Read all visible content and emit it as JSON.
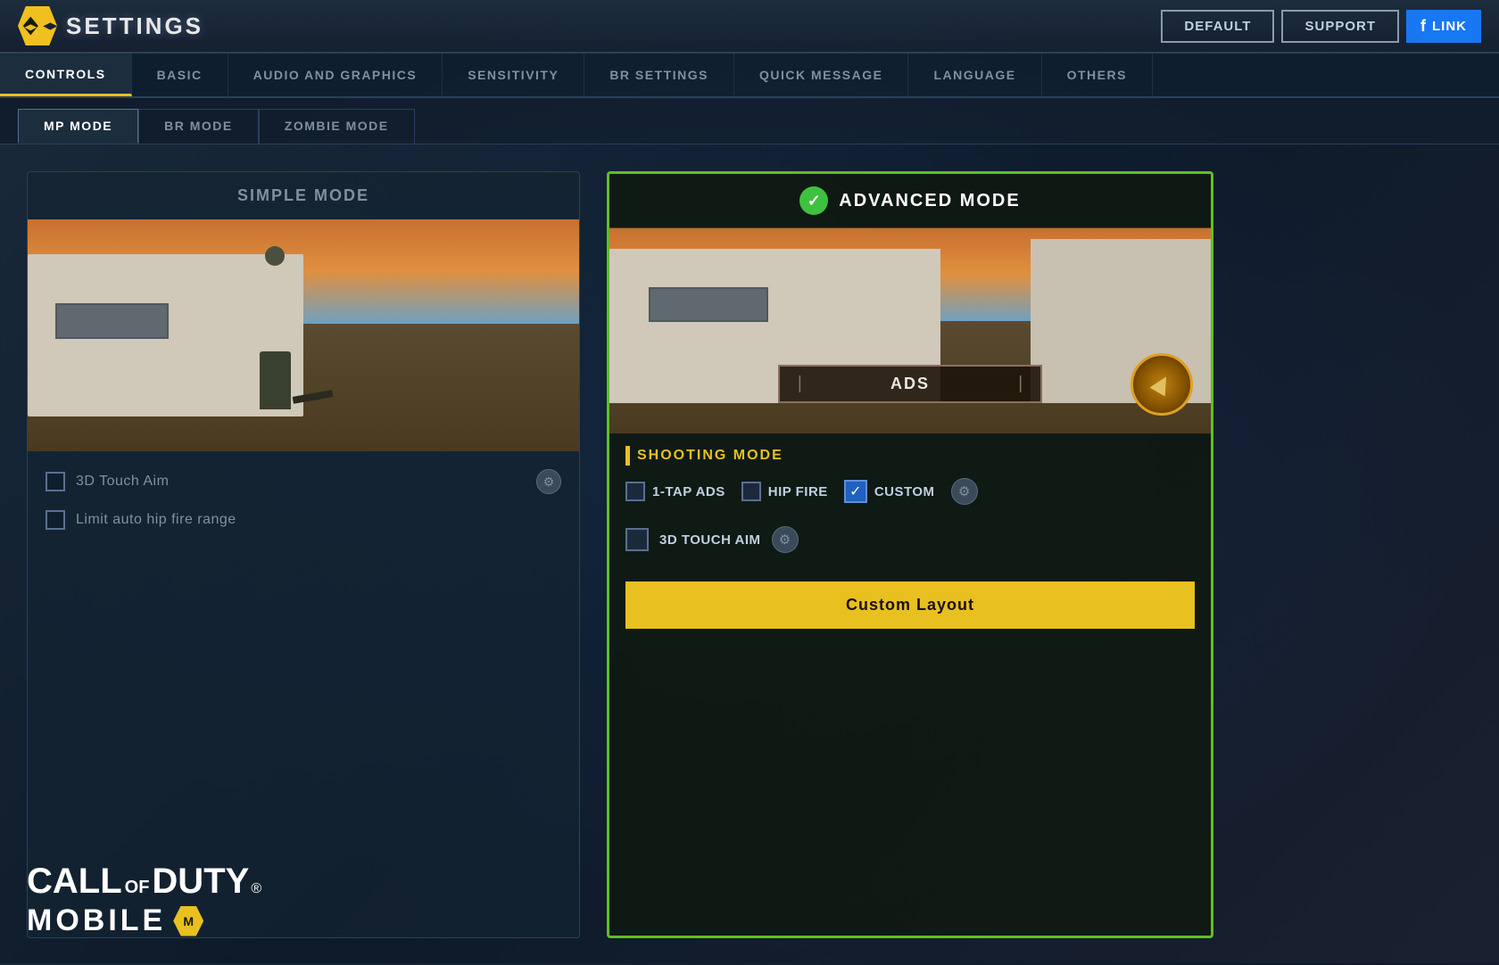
{
  "header": {
    "title": "SETTINGS",
    "default_btn": "DEFAULT",
    "support_btn": "SUPPORT",
    "link_btn": "LINK"
  },
  "tabs": [
    {
      "label": "CONTROLS",
      "active": true
    },
    {
      "label": "BASIC",
      "active": false
    },
    {
      "label": "AUDIO AND GRAPHICS",
      "active": false
    },
    {
      "label": "SENSITIVITY",
      "active": false
    },
    {
      "label": "BR SETTINGS",
      "active": false
    },
    {
      "label": "QUICK MESSAGE",
      "active": false
    },
    {
      "label": "LANGUAGE",
      "active": false
    },
    {
      "label": "OTHERS",
      "active": false
    }
  ],
  "sub_tabs": [
    {
      "label": "MP MODE",
      "active": true
    },
    {
      "label": "BR MODE",
      "active": false
    },
    {
      "label": "ZOMBIE MODE",
      "active": false
    }
  ],
  "simple_mode": {
    "title": "SIMPLE MODE",
    "touch_aim_label": "3D Touch Aim",
    "hip_fire_limit_label": "Limit auto hip fire range"
  },
  "advanced_mode": {
    "title": "ADVANCED MODE",
    "ads_label": "ADS",
    "shooting_mode_title": "SHOOTING MODE",
    "option_1tap_ads": "1-tap ADS",
    "option_hip_fire": "HIP FIRE",
    "option_custom": "CUSTOM",
    "touch_aim_label": "3D Touch Aim",
    "custom_layout_btn": "Custom Layout"
  },
  "codm_logo": {
    "line1": "CALL",
    "of_text": "OF",
    "duty_text": "DUTY",
    "mobile_text": "MOBILE"
  }
}
